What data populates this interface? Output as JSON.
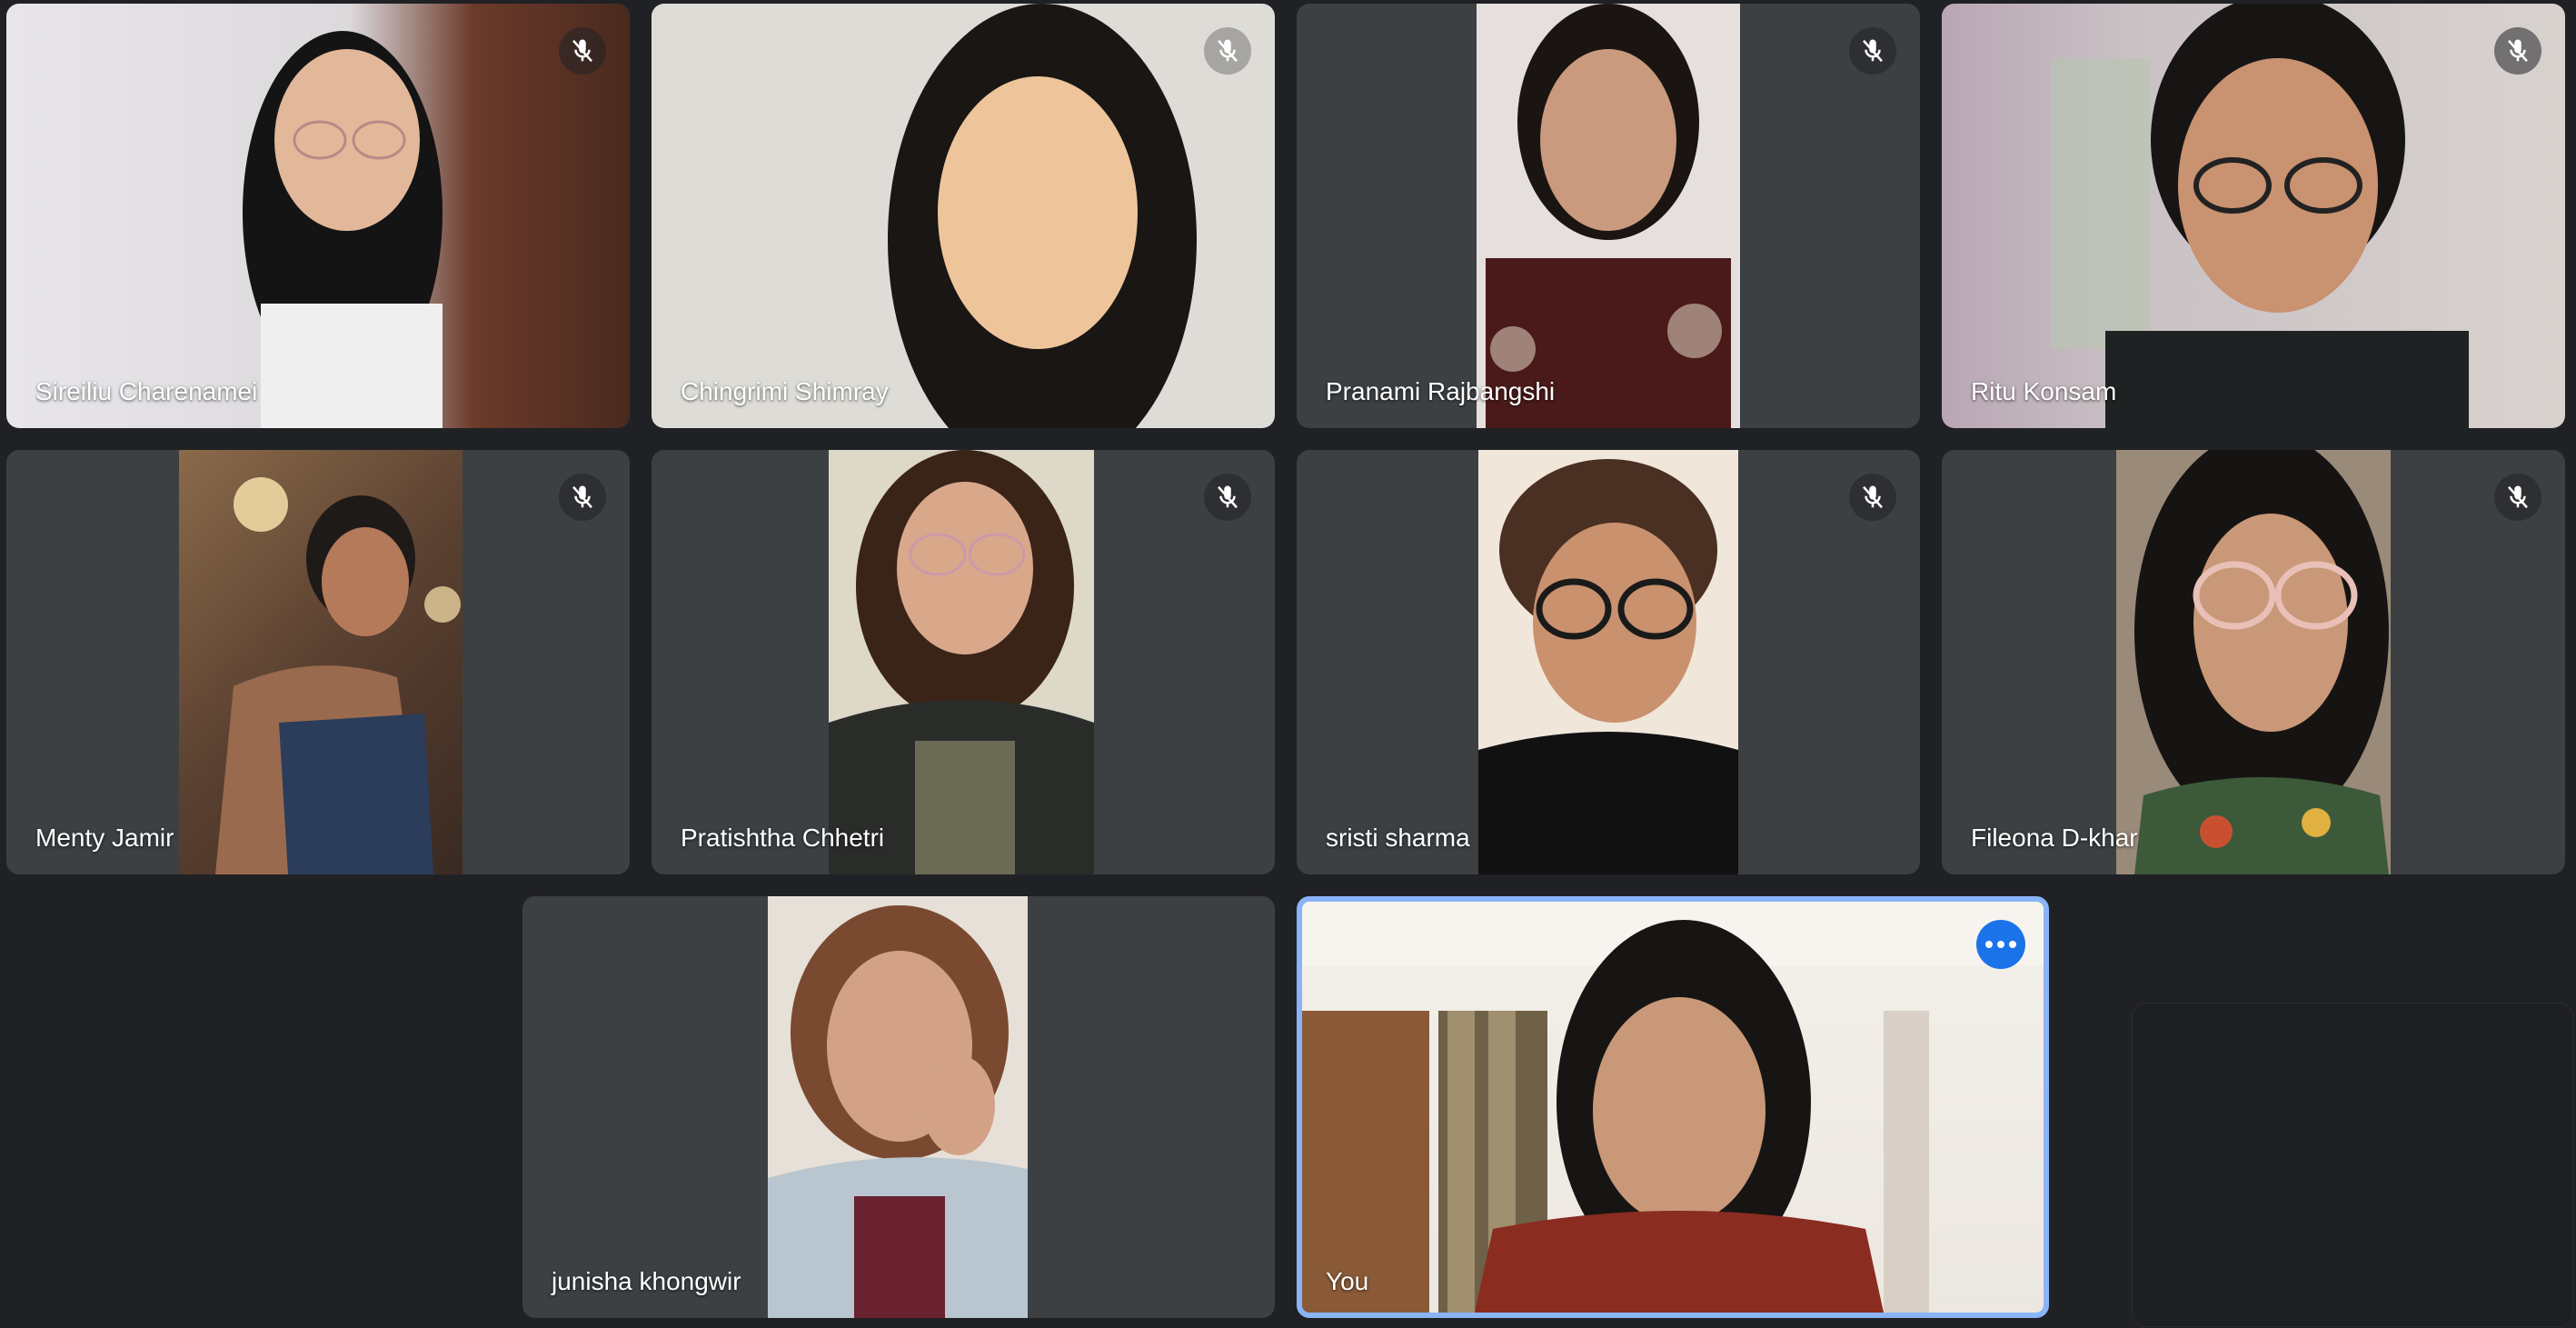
{
  "meeting": {
    "participants": [
      {
        "name": "Sireiliu Charenamei",
        "muted": true
      },
      {
        "name": "Chingrimi Shimray",
        "muted": true
      },
      {
        "name": "Pranami Rajbangshi",
        "muted": true
      },
      {
        "name": "Ritu Konsam",
        "muted": true
      },
      {
        "name": "Menty Jamir",
        "muted": true
      },
      {
        "name": "Pratishtha Chhetri",
        "muted": true
      },
      {
        "name": "sristi sharma",
        "muted": true
      },
      {
        "name": "Fileona D-khar",
        "muted": true
      },
      {
        "name": "junisha khongwir",
        "muted": false
      },
      {
        "name": "You",
        "muted": false,
        "self": true
      }
    ]
  },
  "colors": {
    "background": "#202124",
    "tile": "#3c4043",
    "self_border": "#8ab4f8",
    "more_button": "#1a73e8"
  },
  "icons": {
    "mute": "mic-off-icon",
    "more": "more-options-icon"
  }
}
